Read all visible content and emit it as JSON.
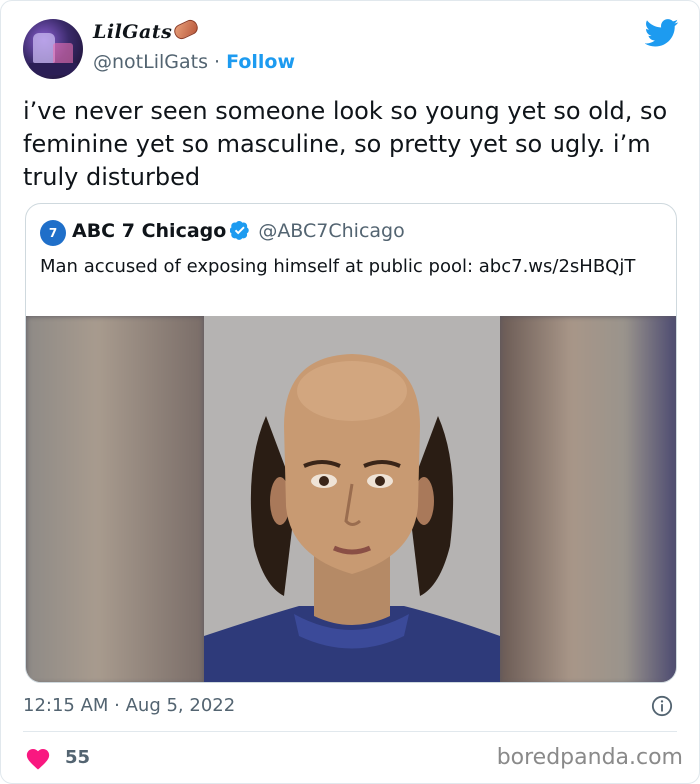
{
  "header": {
    "display_name": "LilGats",
    "handle": "@notLilGats",
    "separator": " · ",
    "follow_label": "Follow",
    "logo_icon": "twitter-bird-icon",
    "logo_color": "#1d9bf0"
  },
  "tweet": {
    "text": "i’ve never seen someone look so young yet so old, so feminine yet so masculine, so pretty yet so ugly. i’m truly disturbed"
  },
  "quoted_tweet": {
    "name": "ABC 7 Chicago",
    "handle": "@ABC7Chicago",
    "text": "Man accused of exposing himself at public pool: abc7.ws/2sHBQjT",
    "verified_icon": "verified-badge-icon",
    "verified_color": "#1d9bf0"
  },
  "footer": {
    "timestamp": "12:15 AM · Aug 5, 2022",
    "likes": "55",
    "heart_color": "#f91880",
    "watermark": "boredpanda.com"
  }
}
